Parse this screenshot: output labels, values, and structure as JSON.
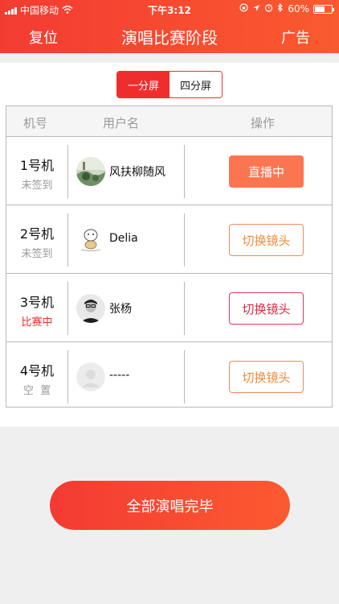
{
  "status_bar": {
    "carrier": "中国移动",
    "time": "下午3:12",
    "battery_percent": "60%",
    "battery_level": 0.6
  },
  "nav": {
    "left": "复位",
    "title": "演唱比赛阶段",
    "right": "广告"
  },
  "segment": {
    "options": [
      "一分屏",
      "四分屏"
    ],
    "selected": 0
  },
  "table": {
    "headers": {
      "machine": "机号",
      "user": "用户名",
      "action": "操作"
    },
    "rows": [
      {
        "machine": "1号机",
        "status": "未签到",
        "user": "风扶柳随风",
        "action": "直播中",
        "avatar": "avatar-landscape"
      },
      {
        "machine": "2号机",
        "status": "未签到",
        "user": "Delia",
        "action": "切换镜头",
        "avatar": "avatar-cartoon"
      },
      {
        "machine": "3号机",
        "status": "比赛中",
        "user": "张杨",
        "action": "切换镜头",
        "avatar": "avatar-portrait"
      },
      {
        "machine": "4号机",
        "status": "空  置",
        "user": "-----",
        "action": "切换镜头",
        "avatar": "avatar-default"
      }
    ]
  },
  "footer": {
    "finish_all": "全部演唱完毕"
  },
  "colors": {
    "primary": "#f33b32",
    "live": "#fb7650",
    "accent_orange": "#f08a3a",
    "accent_red": "#d82a44"
  }
}
